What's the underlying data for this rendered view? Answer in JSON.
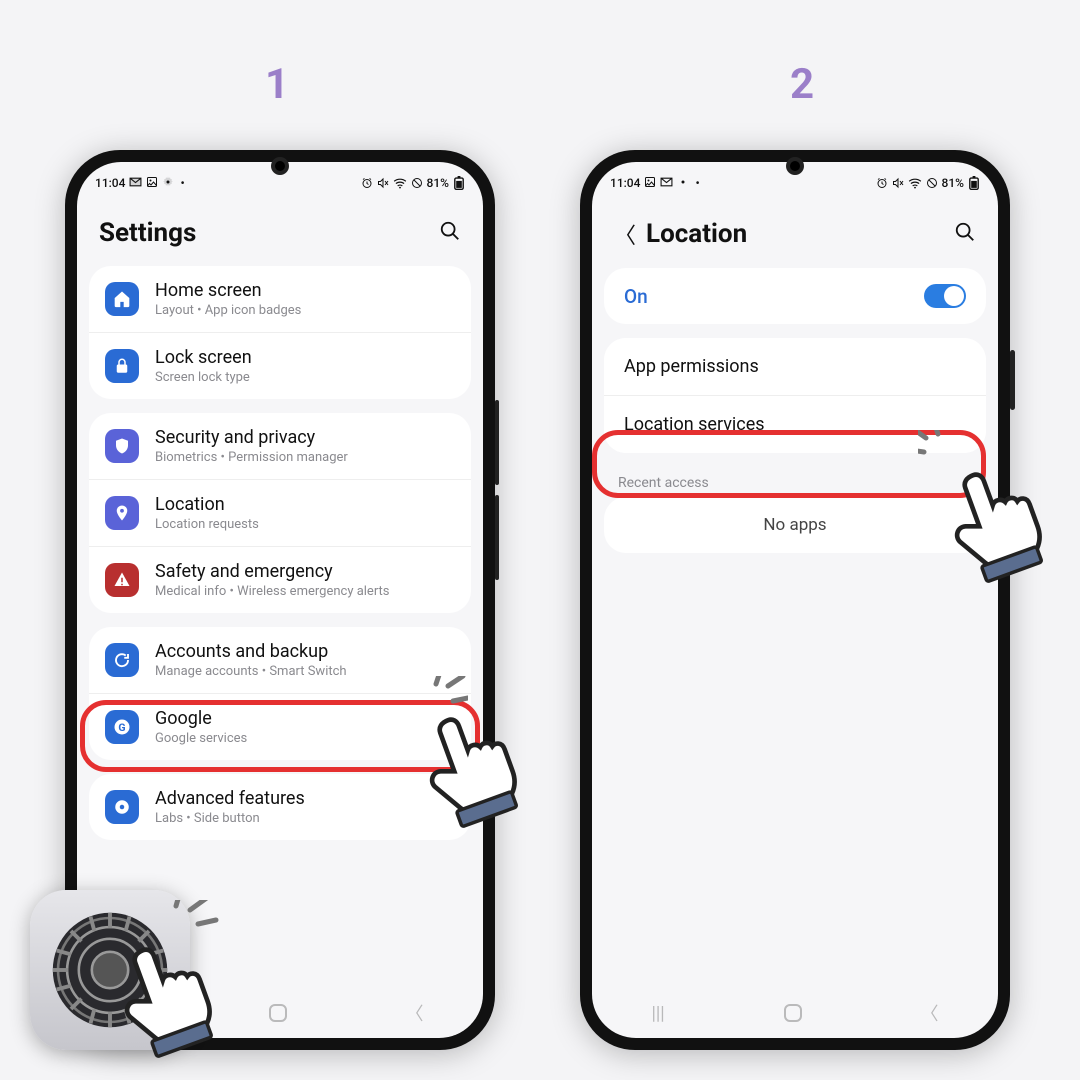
{
  "step_labels": {
    "one": "1",
    "two": "2"
  },
  "status": {
    "time": "11:04",
    "battery": "81%"
  },
  "screen1": {
    "title": "Settings",
    "groups": [
      [
        {
          "icon": "home",
          "color": "#2a6bd4",
          "title": "Home screen",
          "sub": "Layout  •  App icon badges"
        },
        {
          "icon": "lock",
          "color": "#2a6bd4",
          "title": "Lock screen",
          "sub": "Screen lock type"
        }
      ],
      [
        {
          "icon": "shield",
          "color": "#5a63d8",
          "title": "Security and privacy",
          "sub": "Biometrics  •  Permission manager"
        },
        {
          "icon": "pin",
          "color": "#5a63d8",
          "title": "Location",
          "sub": "Location requests"
        },
        {
          "icon": "alert",
          "color": "#b82f2f",
          "title": "Safety and emergency",
          "sub": "Medical info  •  Wireless emergency alerts"
        }
      ],
      [
        {
          "icon": "sync",
          "color": "#2a6bd4",
          "title": "Accounts and backup",
          "sub": "Manage accounts  •  Smart Switch"
        },
        {
          "icon": "g",
          "color": "#2a6bd4",
          "title": "Google",
          "sub": "Google services"
        }
      ],
      [
        {
          "icon": "adv",
          "color": "#2a6bd4",
          "title": "Advanced features",
          "sub": "Labs  •  Side button"
        }
      ]
    ]
  },
  "screen2": {
    "title": "Location",
    "toggle_label": "On",
    "rows": [
      "App permissions",
      "Location services"
    ],
    "section": "Recent access",
    "noapps": "No apps"
  }
}
